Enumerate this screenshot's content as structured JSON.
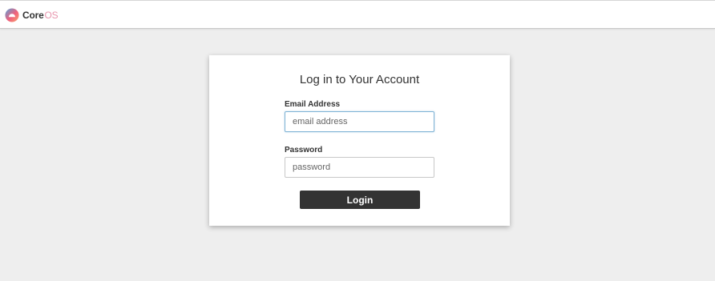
{
  "header": {
    "brand_core": "Core",
    "brand_os": "OS",
    "logo_icon": "coreos-logo-icon"
  },
  "login": {
    "title": "Log in to Your Account",
    "email_label": "Email Address",
    "email_placeholder": "email address",
    "email_value": "",
    "password_label": "Password",
    "password_placeholder": "password",
    "password_value": "",
    "submit_label": "Login"
  },
  "colors": {
    "page_background": "#eeeeee",
    "card_background": "#ffffff",
    "button_background": "#333333",
    "brand_accent": "#e896ae",
    "focus_border": "#7fb3d5"
  }
}
